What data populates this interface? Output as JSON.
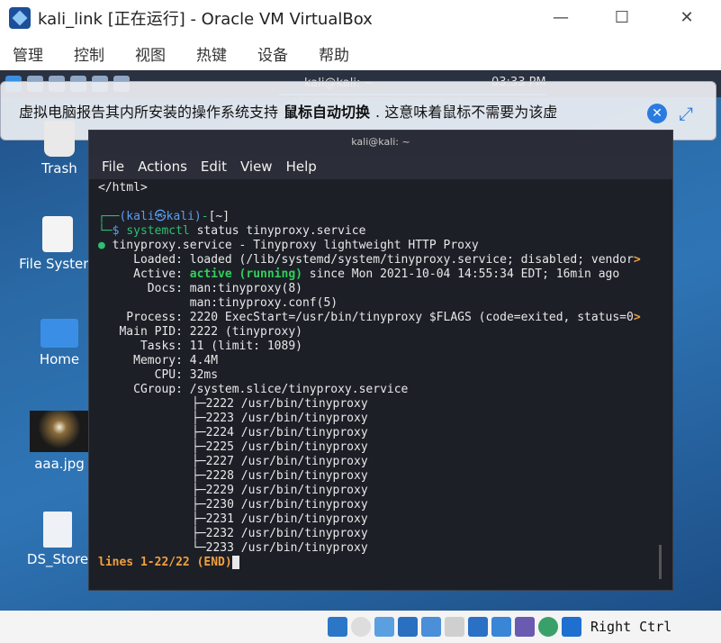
{
  "window": {
    "title": "kali_link [正在运行] - Oracle VM VirtualBox",
    "minimize": "—",
    "maximize": "☐",
    "close": "✕"
  },
  "menubar": [
    "管理",
    "控制",
    "视图",
    "热键",
    "设备",
    "帮助"
  ],
  "panel": {
    "task_label": "kali@kali: ~",
    "clock": "03:33 PM"
  },
  "notification": {
    "text_before": "虚拟电脑报告其内所安装的操作系统支持",
    "text_bold": "鼠标自动切换",
    "text_after": ". 这意味着鼠标不需要为该虚"
  },
  "desktop_icons": [
    "Trash",
    "File System",
    "Home",
    "aaa.jpg",
    "DS_Store"
  ],
  "terminal": {
    "title": "kali@kali: ~",
    "menu": [
      "File",
      "Actions",
      "Edit",
      "View",
      "Help"
    ],
    "lines": {
      "l1": "</html>",
      "l3_user": "(kali㉿kali)",
      "l3_dir": "[~]",
      "l4_cmd": "systemctl",
      "l4_rest": " status tinyproxy.service",
      "l5": "tinyproxy.service - Tinyproxy lightweight HTTP Proxy",
      "l6": "     Loaded: loaded (/lib/systemd/system/tinyproxy.service; disabled; vendor",
      "l7_a": "     Active: ",
      "l7_b": "active (running)",
      "l7_c": " since Mon 2021-10-04 14:55:34 EDT; 16min ago",
      "l8": "       Docs: man:tinyproxy(8)",
      "l9": "             man:tinyproxy.conf(5)",
      "l10": "    Process: 2220 ExecStart=/usr/bin/tinyproxy $FLAGS (code=exited, status=0",
      "l11": "   Main PID: 2222 (tinyproxy)",
      "l12": "      Tasks: 11 (limit: 1089)",
      "l13": "     Memory: 4.4M",
      "l14": "        CPU: 32ms",
      "l15": "     CGroup: /system.slice/tinyproxy.service",
      "cg": [
        "├─2222 /usr/bin/tinyproxy",
        "├─2223 /usr/bin/tinyproxy",
        "├─2224 /usr/bin/tinyproxy",
        "├─2225 /usr/bin/tinyproxy",
        "├─2227 /usr/bin/tinyproxy",
        "├─2228 /usr/bin/tinyproxy",
        "├─2229 /usr/bin/tinyproxy",
        "├─2230 /usr/bin/tinyproxy",
        "├─2231 /usr/bin/tinyproxy",
        "├─2232 /usr/bin/tinyproxy",
        "└─2233 /usr/bin/tinyproxy"
      ],
      "pager": "lines 1-22/22 (END)"
    }
  },
  "status": {
    "host_key": "Right Ctrl"
  }
}
